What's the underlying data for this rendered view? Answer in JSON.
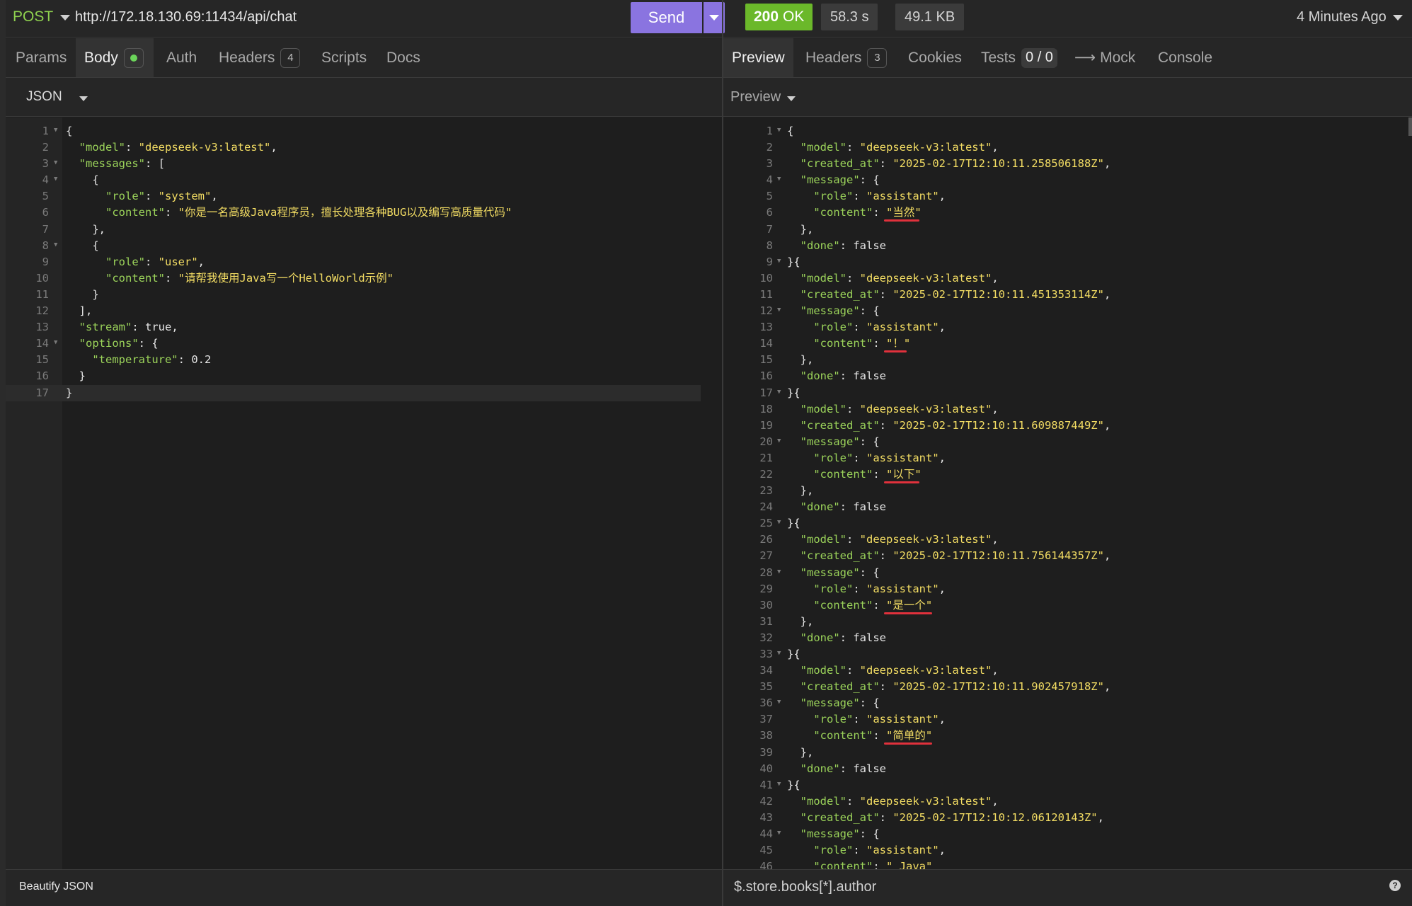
{
  "request": {
    "method": "POST",
    "url": "http://172.18.130.69:11434/api/chat",
    "send_label": "Send",
    "tabs": [
      {
        "label": "Params"
      },
      {
        "label": "Body"
      },
      {
        "label": "Auth"
      },
      {
        "label": "Headers",
        "badge": "4"
      },
      {
        "label": "Scripts"
      },
      {
        "label": "Docs"
      }
    ],
    "body_format": "JSON",
    "beautify_label": "Beautify JSON"
  },
  "response": {
    "status_code": "200",
    "status_text": "OK",
    "time": "58.3 s",
    "size": "49.1 KB",
    "time_ago": "4 Minutes Ago",
    "tabs": [
      {
        "label": "Preview"
      },
      {
        "label": "Headers",
        "badge": "3"
      },
      {
        "label": "Cookies"
      },
      {
        "label": "Tests",
        "badge": "0 / 0"
      },
      {
        "label": "Mock",
        "prefix": "⟶"
      },
      {
        "label": "Console"
      }
    ],
    "preview_label": "Preview",
    "filter_placeholder": "$.store.books[*].author"
  },
  "colors": {
    "accent": "#8a74e0",
    "status_ok": "#6bb82a",
    "json_key": "#9bd35a",
    "json_string": "#f2dc63",
    "underline": "#e0313c"
  },
  "icons": {
    "dropdown": "chevron-down-icon",
    "fold": "fold-arrow-icon",
    "help": "help-icon"
  },
  "request_body_lines": [
    {
      "n": "1",
      "fold": true,
      "t": "{"
    },
    {
      "n": "2",
      "t": "  \"model\": \"deepseek-v3:latest\","
    },
    {
      "n": "3",
      "fold": true,
      "t": "  \"messages\": ["
    },
    {
      "n": "4",
      "fold": true,
      "t": "    {"
    },
    {
      "n": "5",
      "t": "      \"role\": \"system\","
    },
    {
      "n": "6",
      "t": "      \"content\": \"你是一名高级Java程序员，擅长处理各种BUG以及编写高质量代码\""
    },
    {
      "n": "7",
      "t": "    },"
    },
    {
      "n": "8",
      "fold": true,
      "t": "    {"
    },
    {
      "n": "9",
      "t": "      \"role\": \"user\","
    },
    {
      "n": "10",
      "t": "      \"content\": \"请帮我使用Java写一个HelloWorld示例\""
    },
    {
      "n": "11",
      "t": "    }"
    },
    {
      "n": "12",
      "t": "  ],"
    },
    {
      "n": "13",
      "t": "  \"stream\": true,"
    },
    {
      "n": "14",
      "fold": true,
      "t": "  \"options\": {"
    },
    {
      "n": "15",
      "t": "    \"temperature\": 0.2"
    },
    {
      "n": "16",
      "t": "  }"
    },
    {
      "n": "17",
      "t": "}",
      "current": true
    }
  ],
  "response_lines": [
    {
      "n": "1",
      "fold": true,
      "t": "{"
    },
    {
      "n": "2",
      "t": "  \"model\": \"deepseek-v3:latest\","
    },
    {
      "n": "3",
      "t": "  \"created_at\": \"2025-02-17T12:10:11.258506188Z\","
    },
    {
      "n": "4",
      "fold": true,
      "t": "  \"message\": {"
    },
    {
      "n": "5",
      "t": "    \"role\": \"assistant\","
    },
    {
      "n": "6",
      "t": "    \"content\": \"当然\"",
      "underline": true
    },
    {
      "n": "7",
      "t": "  },"
    },
    {
      "n": "8",
      "t": "  \"done\": false"
    },
    {
      "n": "9",
      "fold": true,
      "t": "}{"
    },
    {
      "n": "10",
      "t": "  \"model\": \"deepseek-v3:latest\","
    },
    {
      "n": "11",
      "t": "  \"created_at\": \"2025-02-17T12:10:11.451353114Z\","
    },
    {
      "n": "12",
      "fold": true,
      "t": "  \"message\": {"
    },
    {
      "n": "13",
      "t": "    \"role\": \"assistant\","
    },
    {
      "n": "14",
      "t": "    \"content\": \"！\"",
      "underline": true
    },
    {
      "n": "15",
      "t": "  },"
    },
    {
      "n": "16",
      "t": "  \"done\": false"
    },
    {
      "n": "17",
      "fold": true,
      "t": "}{"
    },
    {
      "n": "18",
      "t": "  \"model\": \"deepseek-v3:latest\","
    },
    {
      "n": "19",
      "t": "  \"created_at\": \"2025-02-17T12:10:11.609887449Z\","
    },
    {
      "n": "20",
      "fold": true,
      "t": "  \"message\": {"
    },
    {
      "n": "21",
      "t": "    \"role\": \"assistant\","
    },
    {
      "n": "22",
      "t": "    \"content\": \"以下\"",
      "underline": true
    },
    {
      "n": "23",
      "t": "  },"
    },
    {
      "n": "24",
      "t": "  \"done\": false"
    },
    {
      "n": "25",
      "fold": true,
      "t": "}{"
    },
    {
      "n": "26",
      "t": "  \"model\": \"deepseek-v3:latest\","
    },
    {
      "n": "27",
      "t": "  \"created_at\": \"2025-02-17T12:10:11.756144357Z\","
    },
    {
      "n": "28",
      "fold": true,
      "t": "  \"message\": {"
    },
    {
      "n": "29",
      "t": "    \"role\": \"assistant\","
    },
    {
      "n": "30",
      "t": "    \"content\": \"是一个\"",
      "underline": true
    },
    {
      "n": "31",
      "t": "  },"
    },
    {
      "n": "32",
      "t": "  \"done\": false"
    },
    {
      "n": "33",
      "fold": true,
      "t": "}{"
    },
    {
      "n": "34",
      "t": "  \"model\": \"deepseek-v3:latest\","
    },
    {
      "n": "35",
      "t": "  \"created_at\": \"2025-02-17T12:10:11.902457918Z\","
    },
    {
      "n": "36",
      "fold": true,
      "t": "  \"message\": {"
    },
    {
      "n": "37",
      "t": "    \"role\": \"assistant\","
    },
    {
      "n": "38",
      "t": "    \"content\": \"简单的\"",
      "underline": true
    },
    {
      "n": "39",
      "t": "  },"
    },
    {
      "n": "40",
      "t": "  \"done\": false"
    },
    {
      "n": "41",
      "fold": true,
      "t": "}{"
    },
    {
      "n": "42",
      "t": "  \"model\": \"deepseek-v3:latest\","
    },
    {
      "n": "43",
      "t": "  \"created_at\": \"2025-02-17T12:10:12.06120143Z\","
    },
    {
      "n": "44",
      "fold": true,
      "t": "  \"message\": {"
    },
    {
      "n": "45",
      "t": "    \"role\": \"assistant\","
    },
    {
      "n": "46",
      "t": "    \"content\": \" Java\""
    }
  ]
}
